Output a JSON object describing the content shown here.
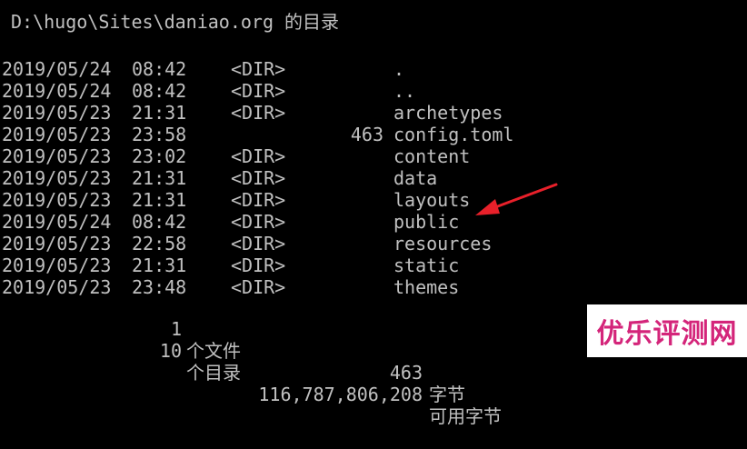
{
  "console": {
    "header": "D:\\hugo\\Sites\\daniao.org 的目录",
    "entries": [
      {
        "date": "2019/05/24",
        "time": "08:42",
        "type": "<DIR>",
        "size": "",
        "name": "."
      },
      {
        "date": "2019/05/24",
        "time": "08:42",
        "type": "<DIR>",
        "size": "",
        "name": ".."
      },
      {
        "date": "2019/05/23",
        "time": "21:31",
        "type": "<DIR>",
        "size": "",
        "name": "archetypes"
      },
      {
        "date": "2019/05/23",
        "time": "23:58",
        "type": "",
        "size": "463",
        "name": "config.toml"
      },
      {
        "date": "2019/05/23",
        "time": "23:02",
        "type": "<DIR>",
        "size": "",
        "name": "content"
      },
      {
        "date": "2019/05/23",
        "time": "21:31",
        "type": "<DIR>",
        "size": "",
        "name": "data"
      },
      {
        "date": "2019/05/23",
        "time": "21:31",
        "type": "<DIR>",
        "size": "",
        "name": "layouts"
      },
      {
        "date": "2019/05/24",
        "time": "08:42",
        "type": "<DIR>",
        "size": "",
        "name": "public"
      },
      {
        "date": "2019/05/23",
        "time": "22:58",
        "type": "<DIR>",
        "size": "",
        "name": "resources"
      },
      {
        "date": "2019/05/23",
        "time": "21:31",
        "type": "<DIR>",
        "size": "",
        "name": "static"
      },
      {
        "date": "2019/05/23",
        "time": "23:48",
        "type": "<DIR>",
        "size": "",
        "name": "themes"
      }
    ],
    "summary": {
      "files_count": "1",
      "files_label": "个文件",
      "files_bytes": "463",
      "files_unit": "字节",
      "dirs_count": "10",
      "dirs_label": "个目录",
      "free_bytes": "116,787,806,208",
      "free_unit": "可用字节"
    }
  },
  "annotation": {
    "arrow_icon": "red-arrow-icon",
    "arrow_color": "#e8202a"
  },
  "watermark": {
    "text": "优乐评测网",
    "color": "#d4257a"
  },
  "colors": {
    "background": "#000000",
    "text": "#c0c0c0"
  }
}
